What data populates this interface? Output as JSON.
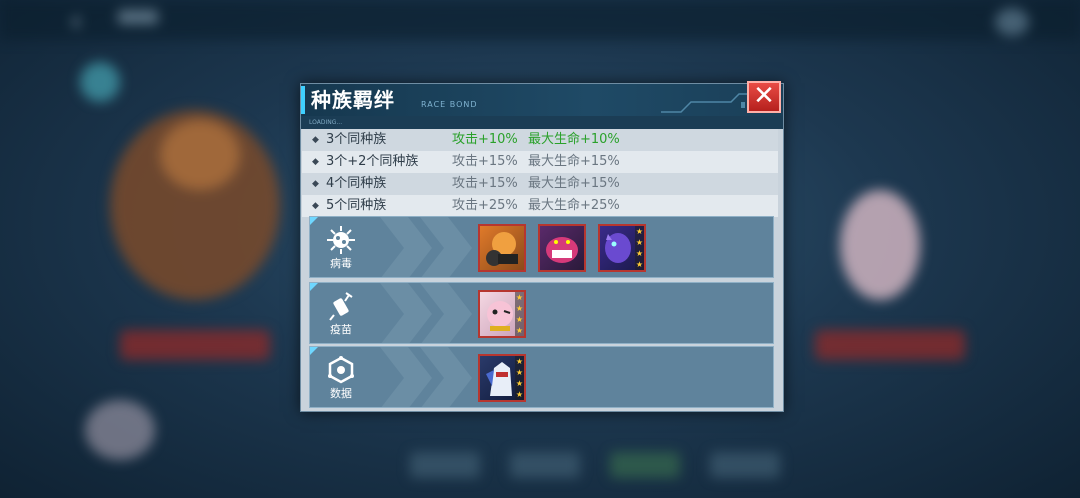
{
  "dialog": {
    "title": "种族羁绊",
    "deco_text": "RACE BOND",
    "loading_text": "LOADING...",
    "close_label": "✕"
  },
  "bonuses": [
    {
      "condition": "3个同种族",
      "attack": "攻击+10%",
      "hp": "最大生命+10%",
      "active": true
    },
    {
      "condition": "3个+2个同种族",
      "attack": "攻击+15%",
      "hp": "最大生命+15%",
      "active": false
    },
    {
      "condition": "4个同种族",
      "attack": "攻击+15%",
      "hp": "最大生命+15%",
      "active": false
    },
    {
      "condition": "5个同种族",
      "attack": "攻击+25%",
      "hp": "最大生命+25%",
      "active": false
    }
  ],
  "races": [
    {
      "label": "病毒",
      "icon": "virus-icon",
      "members": [
        "orange-beast-portrait",
        "pink-dragon-portrait",
        "purple-beast-portrait"
      ]
    },
    {
      "label": "疫苗",
      "icon": "vaccine-icon",
      "members": [
        "pink-bird-portrait"
      ]
    },
    {
      "label": "数据",
      "icon": "data-icon",
      "members": [
        "white-knight-portrait"
      ]
    }
  ],
  "colors": {
    "active_bonus": "#2aa12a",
    "inactive_bonus": "#6a7681",
    "accent": "#3fd0ff",
    "close_red": "#d0302b"
  }
}
